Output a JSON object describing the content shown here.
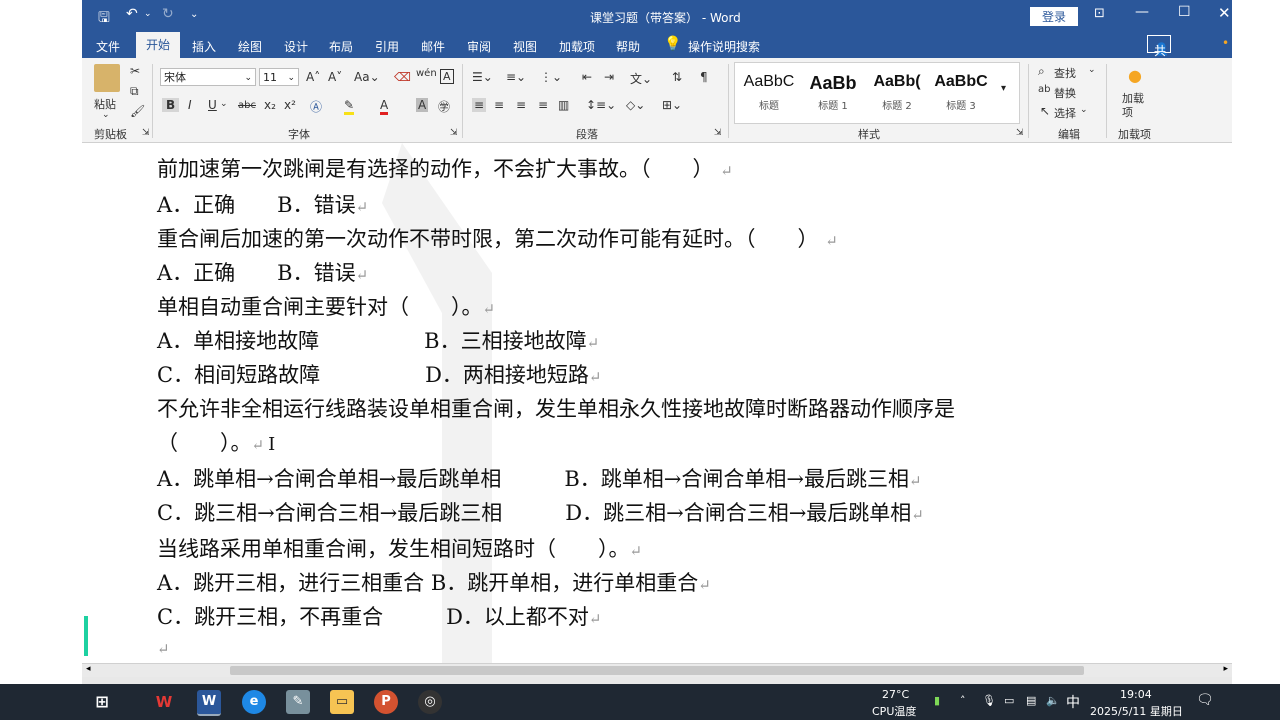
{
  "window": {
    "title": "课堂习题（带答案） - Word",
    "login_label": "登录",
    "share_label": "共享",
    "tell_me": "操作说明搜索"
  },
  "tabs": [
    "文件",
    "开始",
    "插入",
    "绘图",
    "设计",
    "布局",
    "引用",
    "邮件",
    "审阅",
    "视图",
    "加载项",
    "帮助"
  ],
  "ribbon": {
    "clipboard": {
      "paste_label": "粘贴",
      "group_label": "剪贴板"
    },
    "font": {
      "font_name": "宋体",
      "font_size": "11",
      "group_label": "字体"
    },
    "paragraph": {
      "group_label": "段落"
    },
    "styles": {
      "group_label": "样式",
      "items": [
        {
          "preview": "AaBbC",
          "name": "标题"
        },
        {
          "preview": "AaBb",
          "name": "标题 1"
        },
        {
          "preview": "AaBb(",
          "name": "标题 2"
        },
        {
          "preview": "AaBbC",
          "name": "标题 3"
        }
      ]
    },
    "editing": {
      "find": "查找",
      "replace": "替换",
      "select": "选择",
      "group_label": "编辑"
    },
    "addins": {
      "button_label": "加载项",
      "group_label": "加载项"
    }
  },
  "document": {
    "lines": [
      "前加速第一次跳闸是有选择的动作，不会扩大事故。（　　）",
      "A．正确　　B．错误",
      "重合闸后加速的第一次动作不带时限，第二次动作可能有延时。（　　）",
      "A．正确　　B．错误",
      "单相自动重合闸主要针对（　　）。",
      "A．单相接地故障　　　　　B．三相接地故障",
      "C．相间短路故障　　　　　D．两相接地短路",
      "不允许非全相运行线路装设单相重合闸，发生单相永久性接地故障时断路器动作顺序是",
      "（　　）。",
      "A．跳单相→合闸合单相→最后跳单相　　　B．跳单相→合闸合单相→最后跳三相",
      "C．跳三相→合闸合三相→最后跳三相　　　D．跳三相→合闸合三相→最后跳单相",
      "当线路采用单相重合闸，发生相间短路时（　　）。",
      "A．跳开三相，进行三相重合 B．跳开单相，进行单相重合",
      "C．跳开三相，不再重合　　　D．以上都不对"
    ]
  },
  "taskbar": {
    "temperature": "27°C",
    "cpu_label": "CPU温度",
    "ime": "中",
    "time": "19:04",
    "date": "2025/5/11 星期日"
  },
  "colors": {
    "word_blue": "#2b579a",
    "taskbar": "#1f2833"
  }
}
